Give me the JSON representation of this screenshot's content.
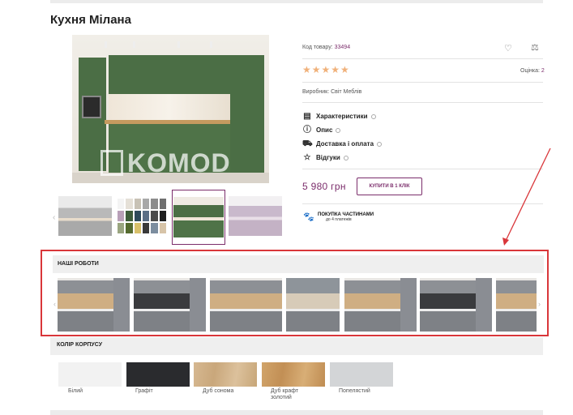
{
  "product": {
    "title": "Кухня Мілана",
    "code_label": "Код товару:",
    "code_value": "33494",
    "stars": "★★★★★",
    "rating_label": "Оцінка:",
    "rating_value": "2",
    "maker": "Виробник: Світ Меблів",
    "watermark": "KOMOD",
    "price": "5 980 грн",
    "buy_button": "КУПИТИ В 1 КЛІК",
    "installment_title": "ПОКУПКА ЧАСТИНАМИ",
    "installment_sub": "до 4 платежів"
  },
  "tabs": [
    {
      "label": "Характеристики",
      "icon": "doc-icon"
    },
    {
      "label": "Опис",
      "icon": "info-icon"
    },
    {
      "label": "Доставка і оплата",
      "icon": "truck-icon"
    },
    {
      "label": "Відгуки",
      "icon": "star-outline-icon"
    }
  ],
  "works": {
    "title": "НАШІ РОБОТИ"
  },
  "colors": {
    "title": "КОЛІР КОРПУСУ",
    "items": [
      {
        "label": "Білий",
        "color": "#f2f2f2"
      },
      {
        "label": "Графіт",
        "color": "#2a2b2e"
      },
      {
        "label": "Дуб сонома",
        "color": "#d2b48c"
      },
      {
        "label": "Дуб крафт золотий",
        "color": "#c99a62"
      },
      {
        "label": "Попелястий",
        "color": "#d3d5d7"
      }
    ]
  },
  "accent": "#7b2d6b",
  "highlight": "#d9363a"
}
